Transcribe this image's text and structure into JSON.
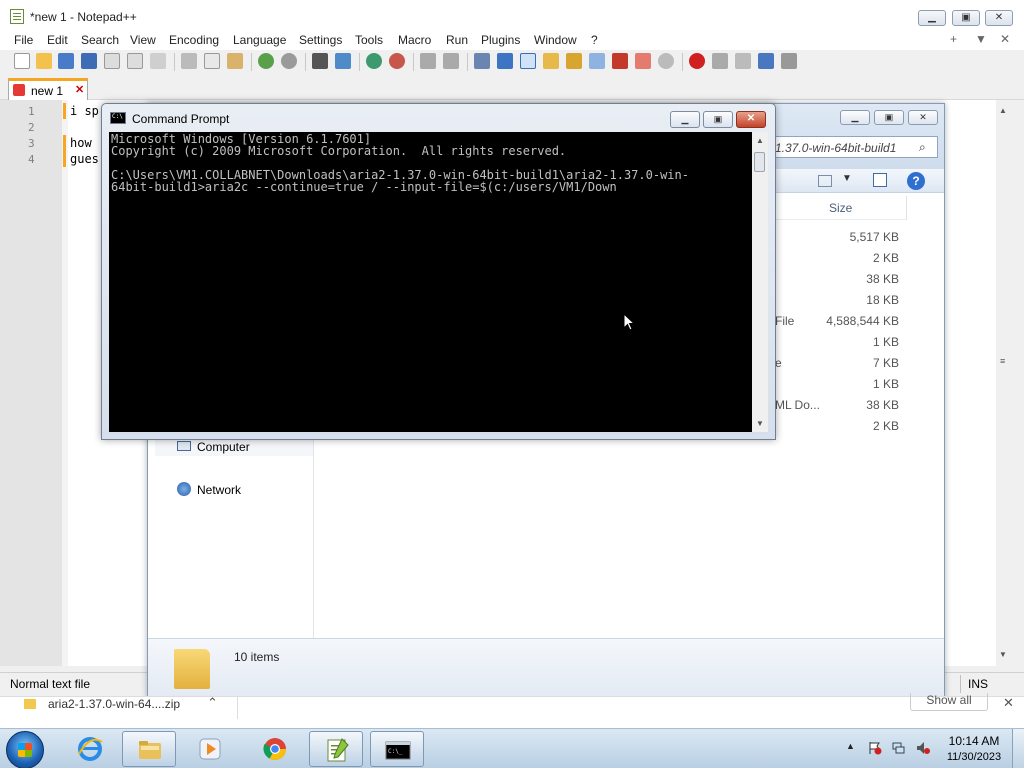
{
  "notepad": {
    "title": "*new 1 - Notepad++",
    "menu": [
      "File",
      "Edit",
      "Search",
      "View",
      "Encoding",
      "Language",
      "Settings",
      "Tools",
      "Macro",
      "Run",
      "Plugins",
      "Window",
      "?"
    ],
    "menu_right": {
      "plus": "+",
      "dropdown": "▼",
      "close": "✕"
    },
    "tab": {
      "label": "new 1",
      "close": "✕"
    },
    "lines": [
      {
        "num": "1",
        "text": "i sp"
      },
      {
        "num": "2",
        "text": ""
      },
      {
        "num": "3",
        "text": "how"
      },
      {
        "num": "4",
        "text": "gues"
      }
    ],
    "status_left": "Normal text file",
    "status_right": "INS",
    "accent": "#f5a623"
  },
  "explorer": {
    "address": "1.37.0-win-64bit-build1",
    "size_header": "Size",
    "rows": [
      {
        "type": "",
        "size": "5,517 KB"
      },
      {
        "type": "",
        "size": "2 KB"
      },
      {
        "type": "",
        "size": "38 KB"
      },
      {
        "type": "",
        "size": "18 KB"
      },
      {
        "type": "File",
        "size": "4,588,544 KB"
      },
      {
        "type": "",
        "size": "1 KB"
      },
      {
        "type": "e",
        "size": "7 KB"
      },
      {
        "type": "",
        "size": "1 KB"
      },
      {
        "type": "ML Do...",
        "size": "38 KB"
      },
      {
        "type": "",
        "size": "2 KB"
      }
    ],
    "nav": {
      "computer": "Computer",
      "network": "Network"
    },
    "items_count": "10 items"
  },
  "cmd": {
    "title": "Command Prompt",
    "output": "Microsoft Windows [Version 6.1.7601]\nCopyright (c) 2009 Microsoft Corporation.  All rights reserved.\n\nC:\\Users\\VM1.COLLABNET\\Downloads\\aria2-1.37.0-win-64bit-build1\\aria2-1.37.0-win-\n64bit-build1>aria2c --continue=true / --input-file=$(c:/users/VM1/Down"
  },
  "download_bar": {
    "filename": "aria2-1.37.0-win-64....zip",
    "show_all": "Show all"
  },
  "taskbar": {
    "apps": [
      "internet-explorer",
      "windows-explorer",
      "media-player",
      "chrome",
      "notepad-plus-plus",
      "command-prompt"
    ],
    "clock_time": "10:14 AM",
    "clock_date": "11/30/2023"
  }
}
